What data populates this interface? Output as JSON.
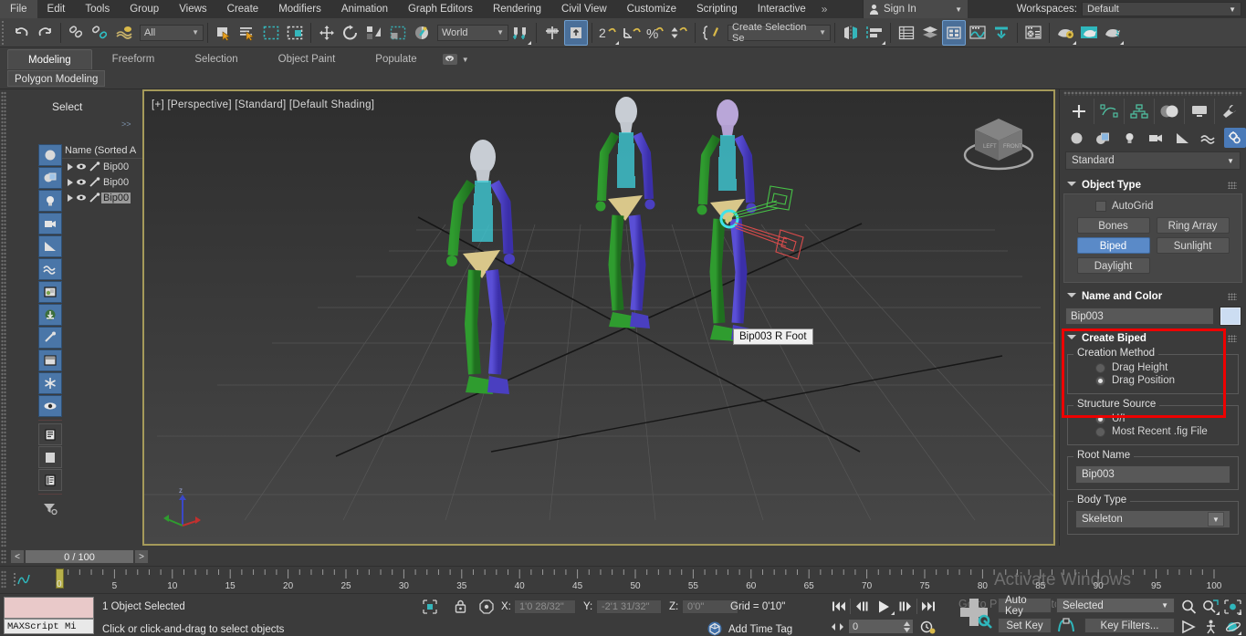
{
  "menu": {
    "items": [
      "File",
      "Edit",
      "Tools",
      "Group",
      "Views",
      "Create",
      "Modifiers",
      "Animation",
      "Graph Editors",
      "Rendering",
      "Civil View",
      "Customize",
      "Scripting",
      "Interactive"
    ],
    "overflow": "»",
    "sign_in": "Sign In",
    "workspaces_label": "Workspaces:",
    "workspace_value": "Default"
  },
  "toolbar": {
    "selection_filter": "All",
    "reference_coord": "World",
    "named_selection_set": "Create Selection Se",
    "icons": [
      "undo-icon",
      "redo-icon",
      "select-and-link-icon",
      "unlink-selection-icon",
      "bind-to-space-warp-icon",
      "select-object-icon",
      "select-by-name-icon",
      "rectangular-selection-region-icon",
      "window-crossing-icon",
      "select-and-move-icon",
      "select-and-rotate-icon",
      "select-and-scale-icon",
      "placement-tool-icon",
      "use-center-flyout-icon",
      "select-and-manipulate-icon",
      "snaps-toggle-icon",
      "angle-snap-toggle-icon",
      "percent-snap-toggle-icon",
      "spinner-snap-toggle-icon",
      "edit-named-selection-icon",
      "mirror-icon",
      "align-icon",
      "layer-explorer-icon",
      "scene-explorer-icon",
      "toggle-ribbon-icon",
      "curve-editor-icon",
      "schematic-view-icon",
      "material-editor-icon",
      "render-setup-icon",
      "rendered-frame-window-icon",
      "render-production-icon"
    ]
  },
  "ribbon": {
    "tabs": [
      "Modeling",
      "Freeform",
      "Selection",
      "Object Paint",
      "Populate"
    ],
    "active_tab": "Modeling",
    "subtab": "Polygon Modeling"
  },
  "left_panel": {
    "title": "Select",
    "more_marker": ">>",
    "list_header": "Name (Sorted A",
    "rows": [
      {
        "name": "Bip00",
        "selected": false
      },
      {
        "name": "Bip00",
        "selected": false
      },
      {
        "name": "Bip00",
        "selected": true
      }
    ],
    "icons": [
      "geometry-filter-icon",
      "shapes-filter-icon",
      "lights-filter-icon",
      "cameras-filter-icon",
      "helpers-filter-icon",
      "space-warps-filter-icon",
      "groups-filter-icon",
      "xrefs-filter-icon",
      "bones-filter-icon",
      "containers-filter-icon",
      "freeze-icon",
      "display-icon",
      "list-icon",
      "blank-icon",
      "layer-list-icon",
      "filter-funnel-icon"
    ]
  },
  "viewport": {
    "label": "[+] [Perspective] [Standard] [Default Shading]",
    "tooltip": "Bip003 R Foot",
    "viewcube": "viewcube-icon",
    "axis_tripod": "axis-tripod-icon"
  },
  "command_panel": {
    "tabs": [
      "create-tab-icon",
      "modify-tab-icon",
      "hierarchy-tab-icon",
      "motion-tab-icon",
      "display-tab-icon",
      "utilities-tab-icon"
    ],
    "object_tabs": [
      {
        "name": "geometry-icon",
        "selected": false
      },
      {
        "name": "shapes-icon",
        "selected": false
      },
      {
        "name": "lights-icon",
        "selected": false
      },
      {
        "name": "cameras-icon",
        "selected": false
      },
      {
        "name": "helpers-icon",
        "selected": false
      },
      {
        "name": "space-warps-icon",
        "selected": false
      },
      {
        "name": "systems-icon",
        "selected": true
      }
    ],
    "category": "Standard",
    "object_type": {
      "title": "Object Type",
      "autogrid_label": "AutoGrid",
      "buttons": [
        {
          "label": "Bones",
          "active": false
        },
        {
          "label": "Ring Array",
          "active": false
        },
        {
          "label": "Biped",
          "active": true
        },
        {
          "label": "Sunlight",
          "active": false
        },
        {
          "label": "Daylight",
          "active": false
        }
      ]
    },
    "name_and_color": {
      "title": "Name and Color",
      "value": "Bip003",
      "color": "#ccddf2"
    },
    "create_biped": {
      "title": "Create Biped",
      "creation_method_label": "Creation Method",
      "creation_options": [
        {
          "label": "Drag Height",
          "selected": false
        },
        {
          "label": "Drag Position",
          "selected": true
        }
      ],
      "structure_source_label": "Structure Source",
      "structure_options": [
        {
          "label": "U/I",
          "selected": true
        },
        {
          "label": "Most Recent .fig File",
          "selected": false
        }
      ],
      "root_name_label": "Root Name",
      "root_name_value": "Bip003",
      "body_type_label": "Body Type",
      "body_type_value": "Skeleton"
    },
    "highlight_color": "#ee0000"
  },
  "time_slider": {
    "prev_label": "<",
    "next_label": ">",
    "frame_text": "0 / 100"
  },
  "track_bar": {
    "tick_labels": [
      "5",
      "10",
      "15",
      "20",
      "25",
      "30",
      "35",
      "40",
      "45",
      "50",
      "55",
      "60",
      "65",
      "70",
      "75",
      "80",
      "85",
      "90",
      "95",
      "100"
    ],
    "current_frame": 0,
    "frame_zero_label": "0",
    "curve_icon": "function-curve-icon"
  },
  "status_bar": {
    "mini_listener": "MAXScript Mi",
    "selection_status": "1 Object Selected",
    "prompt": "Click or click-and-drag to select objects",
    "x_label": "X:",
    "x_value": "1'0 28/32\"",
    "y_label": "Y:",
    "y_value": "-2'1 31/32\"",
    "z_label": "Z:",
    "z_value": "0'0\"",
    "grid_text": "Grid = 0'10\"",
    "add_time_tag": "Add Time Tag",
    "auto_key": "Auto Key",
    "set_key": "Set Key",
    "key_mode": "Selected",
    "key_filters": "Key Filters...",
    "frame_spinner": "0",
    "playback_icons": [
      "go-to-start-icon",
      "previous-frame-icon",
      "play-animation-icon",
      "next-frame-icon",
      "go-to-end-icon"
    ],
    "nav_icons": [
      "zoom-icon",
      "zoom-all-icon",
      "zoom-extents-icon",
      "zoom-region-icon",
      "pan-icon",
      "walk-through-icon",
      "orbit-icon",
      "maximize-viewport-icon"
    ]
  },
  "watermark": {
    "line1": "Activate Windows",
    "line2": "Go to PC settings to activate Windows."
  }
}
